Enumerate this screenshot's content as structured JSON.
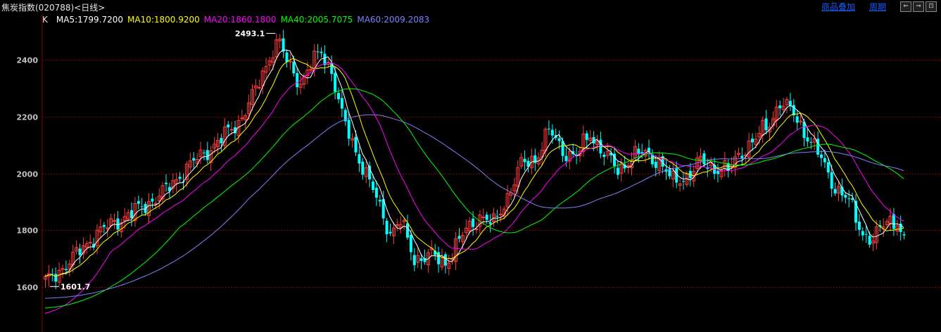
{
  "header": {
    "title": "焦炭指数(020788)<日线>",
    "overlay_label": "商品叠加",
    "period_label": "周期",
    "nav_buttons": [
      "⇐",
      "⇒",
      "⊡"
    ]
  },
  "legend": {
    "indicator": "K",
    "items": [
      {
        "label": "MA5:1799.7200",
        "color": "#ffffff"
      },
      {
        "label": "MA10:1800.9200",
        "color": "#ffff00"
      },
      {
        "label": "MA20:1860.1800",
        "color": "#ff00ff"
      },
      {
        "label": "MA40:2005.7075",
        "color": "#00ff00"
      },
      {
        "label": "MA60:2009.2083",
        "color": "#8080ff"
      }
    ]
  },
  "colors": {
    "up": "#ff3b3b",
    "down": "#00ffff",
    "grid": "#8b0000",
    "axis_text": "#c0c0c0",
    "ma5": "#ffffff",
    "ma10": "#ffff00",
    "ma20": "#ff00ff",
    "ma40": "#00ff00",
    "ma60": "#8080ff"
  },
  "chart_data": {
    "type": "candlestick",
    "y_ticks": [
      1600,
      1800,
      2000,
      2200,
      2400
    ],
    "ylim": [
      1535,
      2550
    ],
    "grid": true,
    "annotations": {
      "high_label": "2493.1",
      "low_label": "1601.7"
    },
    "anchors": [
      {
        "i": 0,
        "c": 1615
      },
      {
        "i": 8,
        "c": 1700
      },
      {
        "i": 15,
        "c": 1790
      },
      {
        "i": 22,
        "c": 1840
      },
      {
        "i": 28,
        "c": 1880
      },
      {
        "i": 35,
        "c": 1940
      },
      {
        "i": 42,
        "c": 2030
      },
      {
        "i": 50,
        "c": 2110
      },
      {
        "i": 56,
        "c": 2180
      },
      {
        "i": 61,
        "c": 2290
      },
      {
        "i": 66,
        "c": 2440
      },
      {
        "i": 68,
        "c": 2460
      },
      {
        "i": 70,
        "c": 2390
      },
      {
        "i": 74,
        "c": 2320
      },
      {
        "i": 77,
        "c": 2380
      },
      {
        "i": 80,
        "c": 2430
      },
      {
        "i": 83,
        "c": 2360
      },
      {
        "i": 86,
        "c": 2200
      },
      {
        "i": 90,
        "c": 2080
      },
      {
        "i": 95,
        "c": 1940
      },
      {
        "i": 100,
        "c": 1790
      },
      {
        "i": 103,
        "c": 1830
      },
      {
        "i": 107,
        "c": 1700
      },
      {
        "i": 112,
        "c": 1710
      },
      {
        "i": 116,
        "c": 1685
      },
      {
        "i": 122,
        "c": 1800
      },
      {
        "i": 126,
        "c": 1850
      },
      {
        "i": 130,
        "c": 1820
      },
      {
        "i": 134,
        "c": 1920
      },
      {
        "i": 138,
        "c": 2030
      },
      {
        "i": 142,
        "c": 2050
      },
      {
        "i": 146,
        "c": 2150
      },
      {
        "i": 150,
        "c": 2080
      },
      {
        "i": 154,
        "c": 2060
      },
      {
        "i": 158,
        "c": 2140
      },
      {
        "i": 162,
        "c": 2070
      },
      {
        "i": 166,
        "c": 2010
      },
      {
        "i": 170,
        "c": 2060
      },
      {
        "i": 174,
        "c": 2070
      },
      {
        "i": 178,
        "c": 2040
      },
      {
        "i": 182,
        "c": 1970
      },
      {
        "i": 186,
        "c": 1990
      },
      {
        "i": 190,
        "c": 2040
      },
      {
        "i": 194,
        "c": 2020
      },
      {
        "i": 198,
        "c": 2010
      },
      {
        "i": 202,
        "c": 2080
      },
      {
        "i": 206,
        "c": 2120
      },
      {
        "i": 210,
        "c": 2180
      },
      {
        "i": 213,
        "c": 2250
      },
      {
        "i": 217,
        "c": 2210
      },
      {
        "i": 221,
        "c": 2130
      },
      {
        "i": 225,
        "c": 2050
      },
      {
        "i": 229,
        "c": 1950
      },
      {
        "i": 233,
        "c": 1900
      },
      {
        "i": 237,
        "c": 1790
      },
      {
        "i": 240,
        "c": 1760
      },
      {
        "i": 244,
        "c": 1840
      },
      {
        "i": 247,
        "c": 1830
      },
      {
        "i": 249,
        "c": 1750
      }
    ],
    "candle_count": 250,
    "high": {
      "i": 67,
      "value": 2493.1
    },
    "low": {
      "i": 1,
      "value": 1601.7
    },
    "ma_periods": [
      5,
      10,
      20,
      40,
      60
    ],
    "ma_warmup": {
      "ma20": [
        1505,
        1500,
        1495
      ],
      "ma40": [
        1525,
        1520,
        1515
      ],
      "ma60": [
        1560,
        1560,
        1560
      ]
    }
  }
}
